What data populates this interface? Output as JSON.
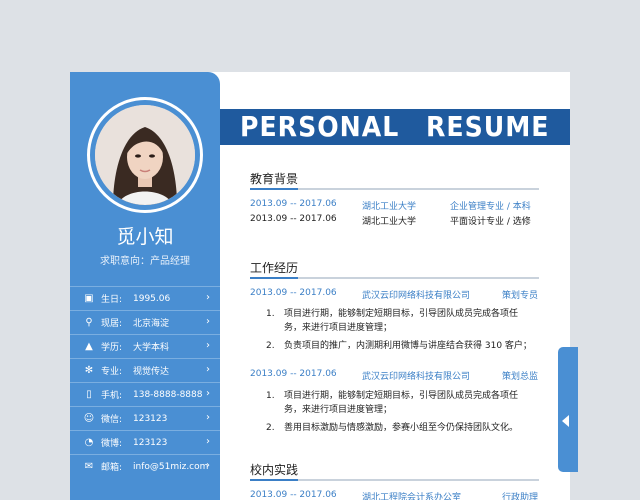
{
  "banner": {
    "word1": "PERSONAL",
    "word2": "RESUME"
  },
  "profile": {
    "name": "觅小知",
    "intent": "求职意向：产品经理"
  },
  "info": [
    {
      "icon": "calendar-icon",
      "glyph": "▣",
      "label": "生日:",
      "value": "1995.06"
    },
    {
      "icon": "location-icon",
      "glyph": "⚲",
      "label": "现居:",
      "value": "北京海淀"
    },
    {
      "icon": "graduation-cap-icon",
      "glyph": "▲",
      "label": "学历:",
      "value": "大学本科"
    },
    {
      "icon": "gear-icon",
      "glyph": "✻",
      "label": "专业:",
      "value": "视觉传达"
    },
    {
      "icon": "phone-icon",
      "glyph": "▯",
      "label": "手机:",
      "value": "138-8888-8888"
    },
    {
      "icon": "wechat-icon",
      "glyph": "☺",
      "label": "微信:",
      "value": "123123"
    },
    {
      "icon": "weibo-icon",
      "glyph": "◔",
      "label": "微博:",
      "value": "123123"
    },
    {
      "icon": "mail-icon",
      "glyph": "✉",
      "label": "邮箱:",
      "value": "info@51miz.com"
    }
  ],
  "education": {
    "title": "教育背景",
    "rows": [
      {
        "period": "2013.09 -- 2017.06",
        "school": "湖北工业大学",
        "major": "企业管理专业 / 本科"
      },
      {
        "period": "2013.09 -- 2017.06",
        "school": "湖北工业大学",
        "major": "平面设计专业 / 选修"
      }
    ]
  },
  "work": {
    "title": "工作经历",
    "jobs": [
      {
        "period": "2013.09 -- 2017.06",
        "company": "武汉云印网络科技有限公司",
        "role": "策划专员",
        "items": [
          {
            "num": "1.",
            "lines": [
              "项目进行期，能够制定短期目标，引导团队成员完成各项任",
              "务，来进行项目进度管理；"
            ]
          },
          {
            "num": "2.",
            "lines": [
              "负责项目的推广，内测期利用微博与讲座结合获得 310 客户；"
            ]
          }
        ]
      },
      {
        "period": "2013.09 -- 2017.06",
        "company": "武汉云印网络科技有限公司",
        "role": "策划总监",
        "items": [
          {
            "num": "1.",
            "lines": [
              "项目进行期，能够制定短期目标，引导团队成员完成各项任",
              "务，来进行项目进度管理；"
            ]
          },
          {
            "num": "2.",
            "lines": [
              "善用目标激励与情感激励，参赛小组至今仍保持团队文化。"
            ]
          }
        ]
      }
    ]
  },
  "campus": {
    "title": "校内实践",
    "row": {
      "period": "2013.09 -- 2017.06",
      "org": "湖北工程院会计系办公室",
      "role": "行政助理"
    }
  },
  "colors": {
    "sidebar": "#4a8fd3",
    "banner": "#1f5a9e",
    "accent": "#3b7fc6"
  }
}
